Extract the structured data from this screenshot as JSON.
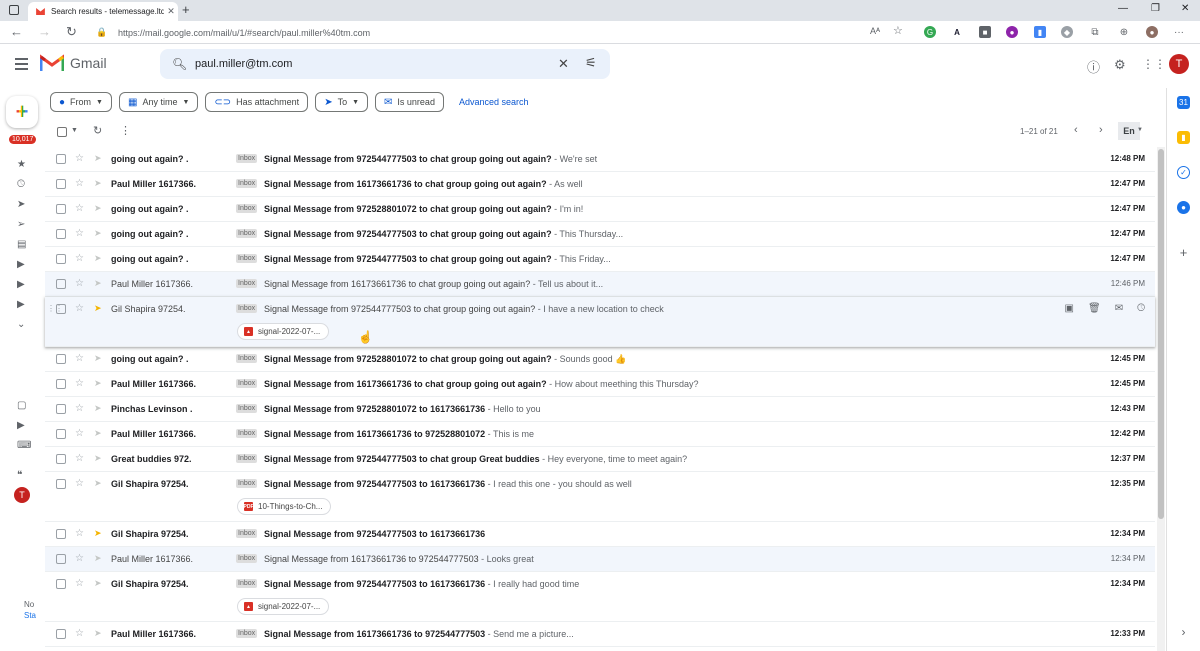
{
  "browser": {
    "tab_title": "Search results - telemessage.ltd",
    "new_tab": "+",
    "url": "https://mail.google.com/mail/u/1/#search/paul.miller%40tm.com",
    "window_controls": [
      "—",
      "❐",
      "✕"
    ]
  },
  "gmail": {
    "brand": "Gmail",
    "search_value": "paul.miller@tm.com",
    "avatar_letter": "T",
    "unread_badge": "10,017",
    "rail_bottom_text": [
      "No",
      "Sta"
    ]
  },
  "filters": {
    "chips": [
      {
        "label": "From",
        "icon": "person-icon",
        "dropdown": true
      },
      {
        "label": "Any time",
        "icon": "calendar-icon",
        "dropdown": true
      },
      {
        "label": "Has attachment",
        "icon": "attachment-icon",
        "dropdown": false
      },
      {
        "label": "To",
        "icon": "send-icon",
        "dropdown": true
      },
      {
        "label": "Is unread",
        "icon": "unread-icon",
        "dropdown": false
      }
    ],
    "advanced": "Advanced search"
  },
  "toolbar": {
    "pagination": "1–21 of 21",
    "language": "En"
  },
  "tag_label": "Inbox",
  "emails": [
    {
      "sender": "going out again? .",
      "subject": "Signal Message from 972544777503 to chat group going out again?",
      "snippet": " - We're set",
      "time": "12:48 PM",
      "read": false,
      "important": false
    },
    {
      "sender": "Paul Miller 1617366.",
      "subject": "Signal Message from 16173661736 to chat group going out again?",
      "snippet": " - As well",
      "time": "12:47 PM",
      "read": false,
      "important": false
    },
    {
      "sender": "going out again? .",
      "subject": "Signal Message from 972528801072 to chat group going out again?",
      "snippet": " - I'm in!",
      "time": "12:47 PM",
      "read": false,
      "important": false
    },
    {
      "sender": "going out again? .",
      "subject": "Signal Message from 972544777503 to chat group going out again?",
      "snippet": " - This Thursday...",
      "time": "12:47 PM",
      "read": false,
      "important": false
    },
    {
      "sender": "going out again? .",
      "subject": "Signal Message from 972544777503 to chat group going out again?",
      "snippet": " - This Friday...",
      "time": "12:47 PM",
      "read": false,
      "important": false
    },
    {
      "sender": "Paul Miller 1617366.",
      "subject": "Signal Message from 16173661736 to chat group going out again?",
      "snippet": " - Tell us about it...",
      "time": "12:46 PM",
      "read": true,
      "important": false
    },
    {
      "sender": "Gil Shapira 97254.",
      "subject": "Signal Message from 972544777503 to chat group going out again?",
      "snippet": " - I have a new location to check",
      "time": "",
      "read": true,
      "important": true,
      "attachment": "signal-2022-07-...",
      "attachment_type": "image",
      "hover": true
    },
    {
      "sender": "going out again? .",
      "subject": "Signal Message from 972528801072 to chat group going out again?",
      "snippet": " - Sounds good 👍",
      "time": "12:45 PM",
      "read": false,
      "important": false
    },
    {
      "sender": "Paul Miller 1617366.",
      "subject": "Signal Message from 16173661736 to chat group going out again?",
      "snippet": " - How about meething this Thursday?",
      "time": "12:45 PM",
      "read": false,
      "important": false
    },
    {
      "sender": "Pinchas Levinson .",
      "subject": "Signal Message from 972528801072 to 16173661736",
      "snippet": " - Hello to you",
      "time": "12:43 PM",
      "read": false,
      "important": false
    },
    {
      "sender": "Paul Miller 1617366.",
      "subject": "Signal Message from 16173661736 to 972528801072",
      "snippet": " - This is me",
      "time": "12:42 PM",
      "read": false,
      "important": false
    },
    {
      "sender": "Great buddies 972.",
      "subject": "Signal Message from 972544777503 to chat group Great buddies",
      "snippet": " - Hey everyone, time to meet again?",
      "time": "12:37 PM",
      "read": false,
      "important": false
    },
    {
      "sender": "Gil Shapira 97254.",
      "subject": "Signal Message from 972544777503 to 16173661736",
      "snippet": " - I read this one - you should as well",
      "time": "12:35 PM",
      "read": false,
      "important": false,
      "attachment": "10-Things-to-Ch...",
      "attachment_type": "pdf"
    },
    {
      "sender": "Gil Shapira 97254.",
      "subject": "Signal Message from 972544777503 to 16173661736",
      "snippet": "",
      "time": "12:34 PM",
      "read": false,
      "important": true
    },
    {
      "sender": "Paul Miller 1617366.",
      "subject": "Signal Message from 16173661736 to 972544777503",
      "snippet": " - Looks great",
      "time": "12:34 PM",
      "read": true,
      "important": false
    },
    {
      "sender": "Gil Shapira 97254.",
      "subject": "Signal Message from 972544777503 to 16173661736",
      "snippet": " - I really had good time",
      "time": "12:34 PM",
      "read": false,
      "important": false,
      "attachment": "signal-2022-07-...",
      "attachment_type": "image"
    },
    {
      "sender": "Paul Miller 1617366.",
      "subject": "Signal Message from 16173661736 to 972544777503",
      "snippet": " - Send me a picture...",
      "time": "12:33 PM",
      "read": false,
      "important": false
    }
  ],
  "colors": {
    "gmail_red": "#d93025",
    "important_yellow": "#f4b400",
    "link_blue": "#0b57d0",
    "search_bg": "#eaf1fb"
  }
}
